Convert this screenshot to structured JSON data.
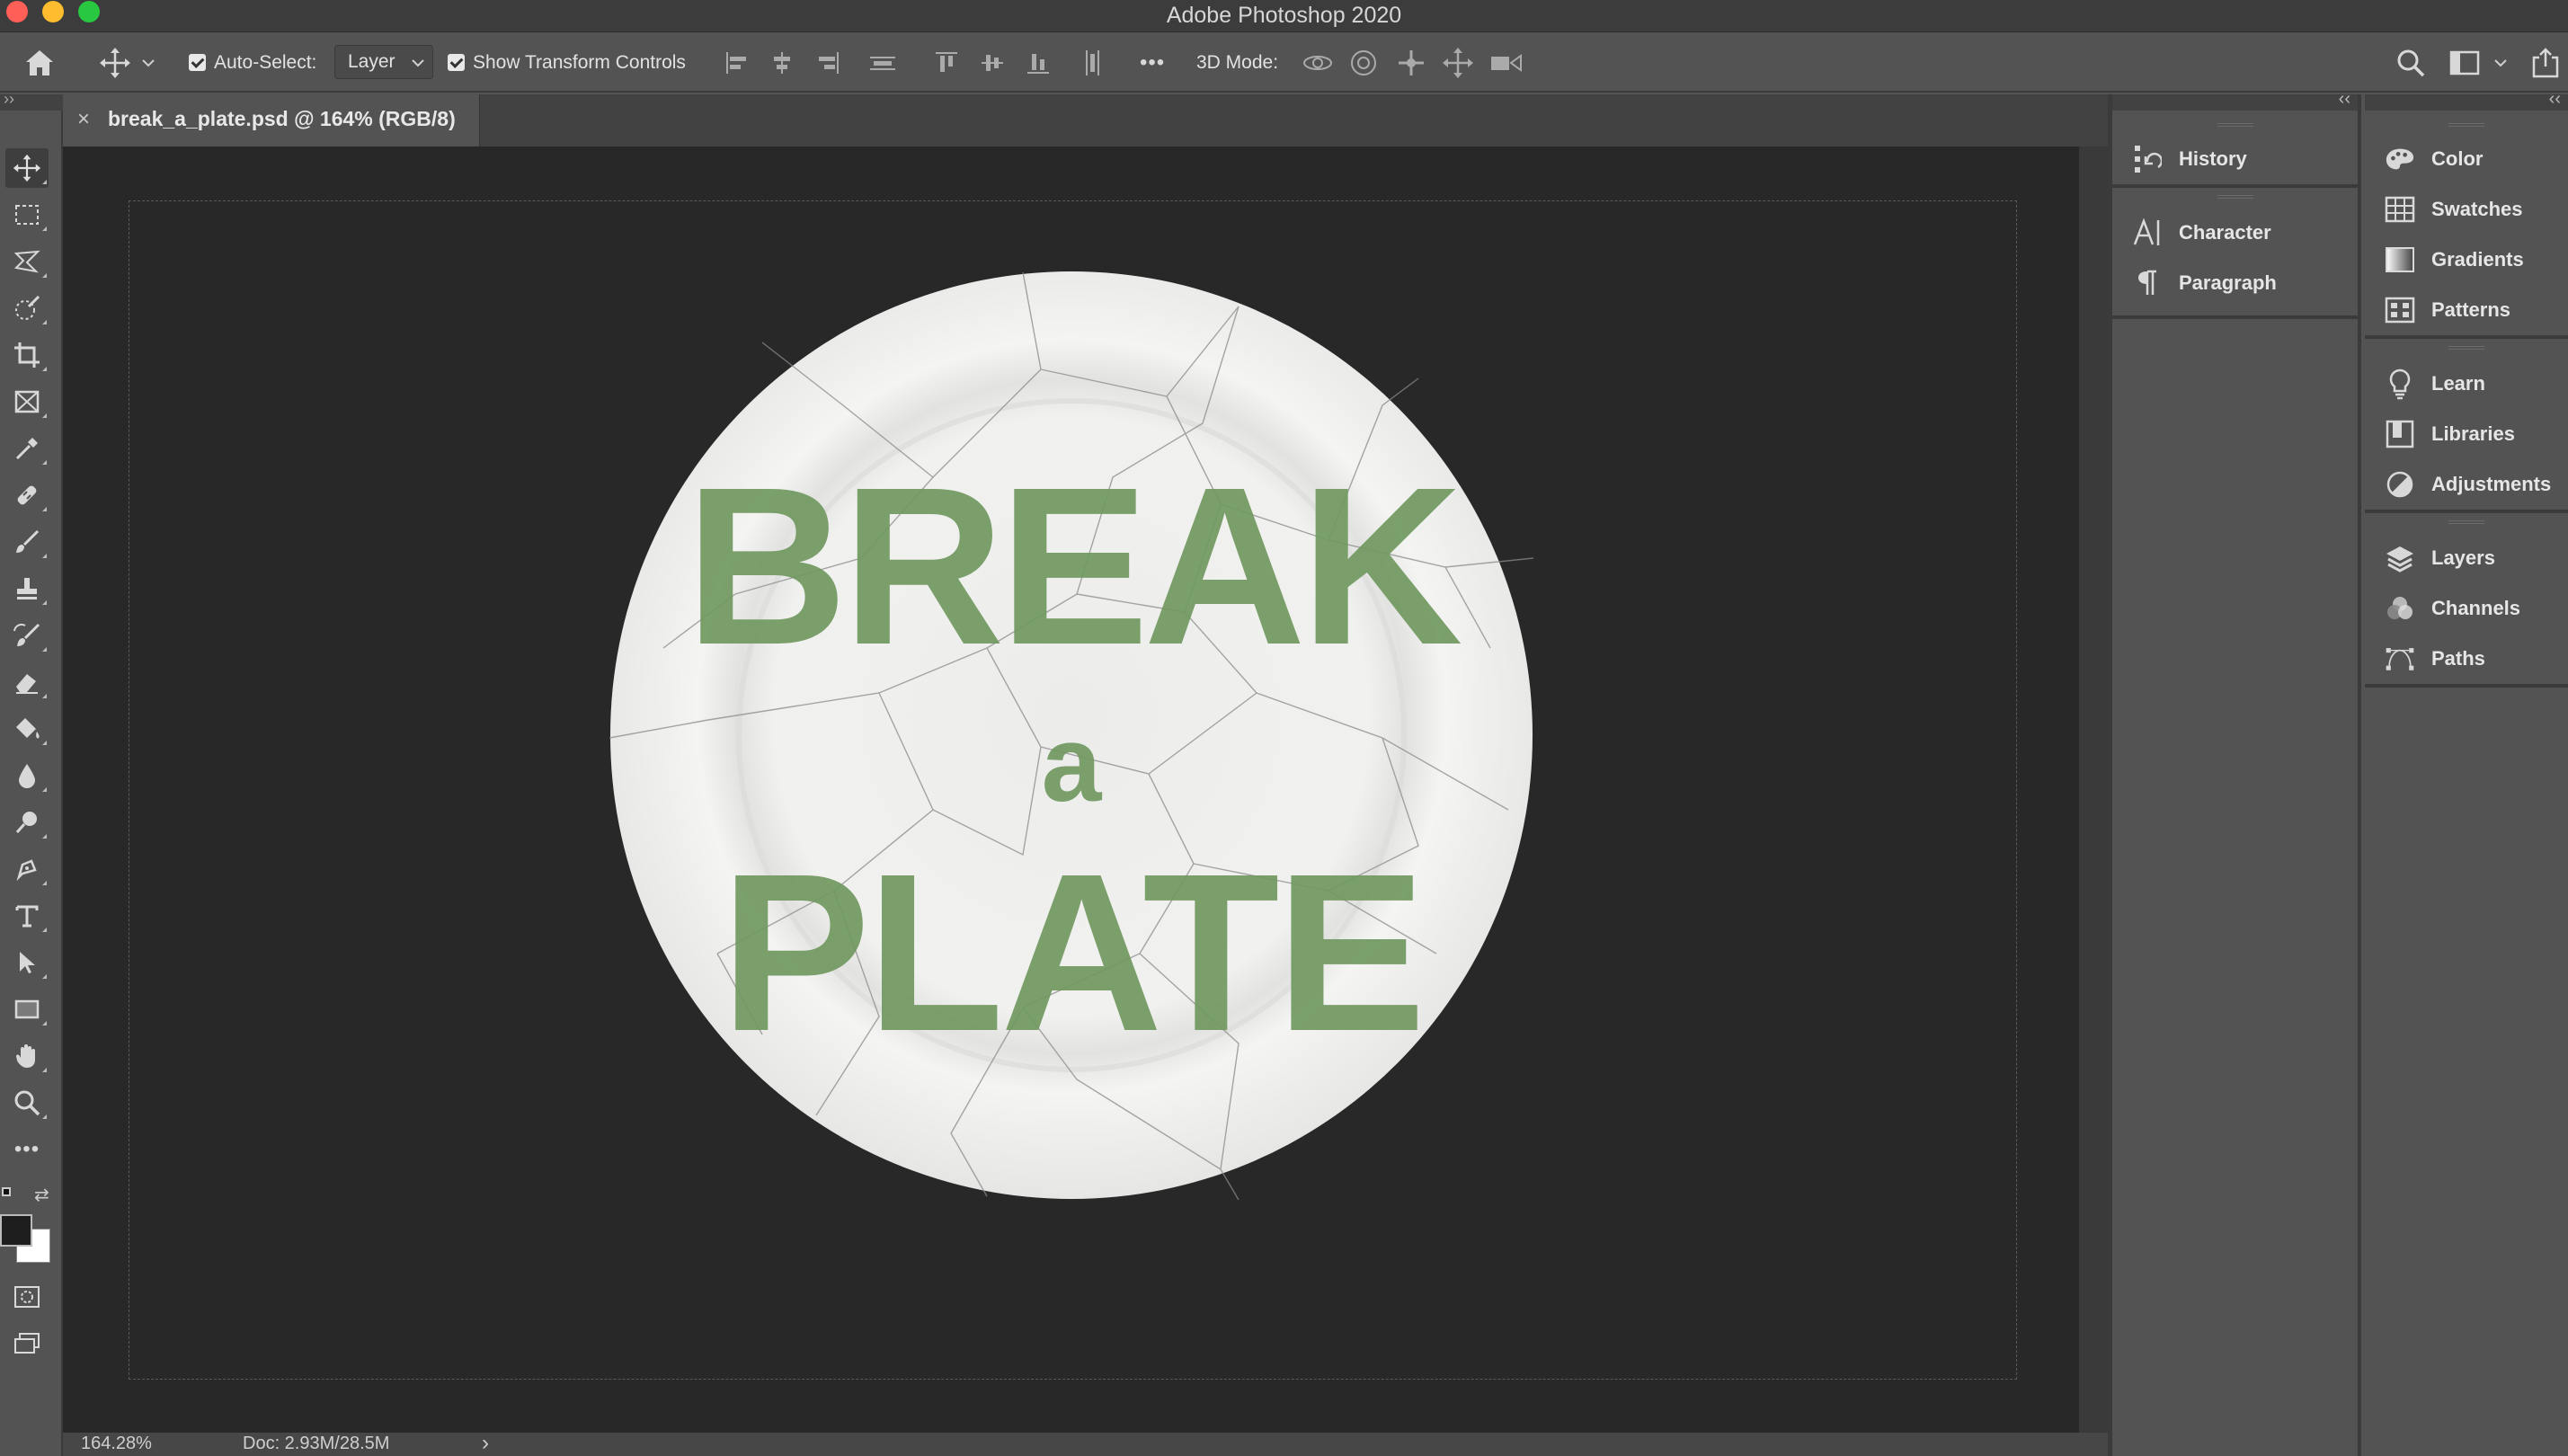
{
  "window": {
    "title": "Adobe Photoshop 2020"
  },
  "options_bar": {
    "auto_select_label": "Auto-Select:",
    "auto_select_checked": true,
    "auto_select_target": "Layer",
    "show_transform_label": "Show Transform Controls",
    "show_transform_checked": true,
    "more_label": "•••",
    "mode_3d_label": "3D Mode:"
  },
  "document_tab": {
    "close_glyph": "×",
    "name": "break_a_plate.psd @ 164% (RGB/8)"
  },
  "canvas": {
    "text_line1": "BREAK",
    "text_line2": "a",
    "text_line3": "PLATE",
    "text_color": "#6f9860",
    "background_color": "#282828"
  },
  "status_bar": {
    "zoom": "164.28%",
    "doc_size": "Doc: 2.93M/28.5M",
    "arrow": "›"
  },
  "panels": {
    "collapse_glyph": "‹‹",
    "group_a": [
      {
        "label": "History",
        "icon": "history-icon"
      },
      {
        "label": "Character",
        "icon": "character-icon"
      },
      {
        "label": "Paragraph",
        "icon": "paragraph-icon"
      }
    ],
    "group_b": [
      {
        "label": "Color",
        "icon": "color-palette-icon"
      },
      {
        "label": "Swatches",
        "icon": "swatches-icon"
      },
      {
        "label": "Gradients",
        "icon": "gradients-icon"
      },
      {
        "label": "Patterns",
        "icon": "patterns-icon"
      },
      {
        "label": "Learn",
        "icon": "learn-bulb-icon"
      },
      {
        "label": "Libraries",
        "icon": "libraries-icon"
      },
      {
        "label": "Adjustments",
        "icon": "adjustments-icon"
      },
      {
        "label": "Layers",
        "icon": "layers-icon"
      },
      {
        "label": "Channels",
        "icon": "channels-icon"
      },
      {
        "label": "Paths",
        "icon": "paths-icon"
      }
    ]
  },
  "tools": [
    "move-tool-icon",
    "marquee-tool-icon",
    "lasso-tool-icon",
    "quick-selection-tool-icon",
    "crop-tool-icon",
    "frame-tool-icon",
    "eyedropper-tool-icon",
    "healing-brush-tool-icon",
    "brush-tool-icon",
    "clone-stamp-tool-icon",
    "history-brush-tool-icon",
    "eraser-tool-icon",
    "paint-bucket-tool-icon",
    "blur-tool-icon",
    "dodge-tool-icon",
    "pen-tool-icon",
    "type-tool-icon",
    "path-selection-tool-icon",
    "rectangle-tool-icon",
    "hand-tool-icon",
    "zoom-tool-icon",
    "edit-toolbar-icon"
  ],
  "colors": {
    "foreground": "#1e1e1e",
    "background": "#ffffff",
    "ui_bg": "#535353",
    "ui_dark": "#3b3b3b"
  }
}
